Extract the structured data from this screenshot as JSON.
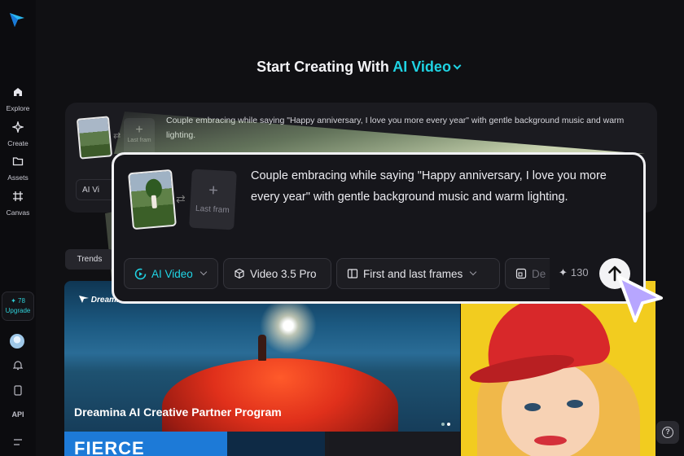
{
  "sidebar": {
    "items": [
      {
        "label": "Explore",
        "icon": "home-icon"
      },
      {
        "label": "Create",
        "icon": "sparkle-icon"
      },
      {
        "label": "Assets",
        "icon": "folder-icon"
      },
      {
        "label": "Canvas",
        "icon": "canvas-icon"
      }
    ],
    "credits": "✦ 78",
    "upgrade": "Upgrade",
    "api": "API"
  },
  "heading": {
    "prefix": "Start Creating With",
    "mode": "AI Video"
  },
  "background_card": {
    "prompt": "Couple embracing while saying \"Happy anniversary, I love you more every year\" with gentle background music and warm lighting.",
    "last_frame": "Last fram",
    "chip": "AI Vi"
  },
  "focus_card": {
    "prompt": "Couple embracing while saying \"Happy anniversary, I love you more every year\" with gentle background music and warm lighting.",
    "last_frame": "Last fram",
    "chips": {
      "mode": "AI Video",
      "model": "Video 3.5 Pro",
      "frames": "First and last frames",
      "extra": "De"
    },
    "credits": "130"
  },
  "trends": "Trends",
  "banner": {
    "brand": "Dreamina",
    "title": "Dreamina AI Creative Partner Program",
    "fierce": "FIERCE"
  },
  "help": "?",
  "colors": {
    "accent": "#1fd3e3",
    "background": "#101013",
    "cursor": "#b7a6ff"
  }
}
